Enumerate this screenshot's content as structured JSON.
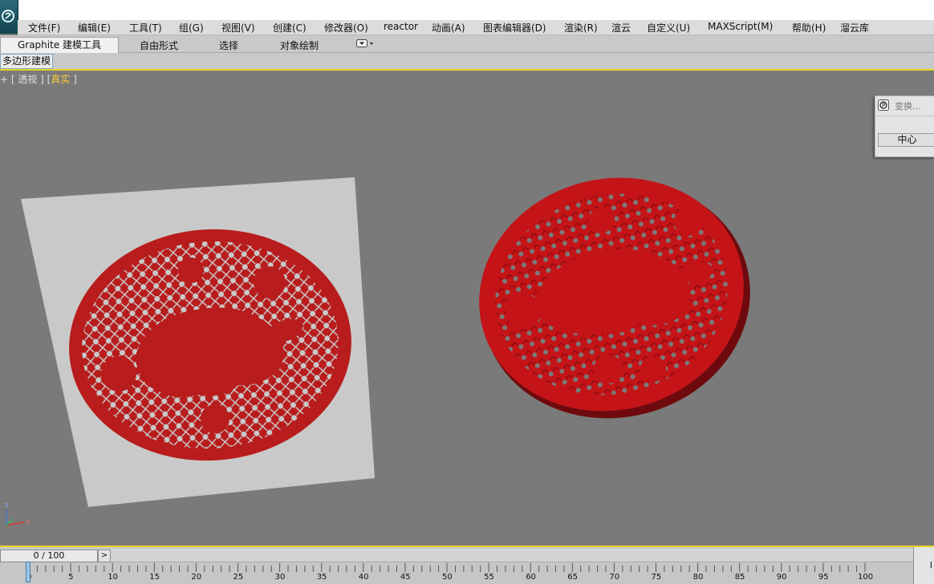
{
  "menubar": {
    "items": [
      "文件(F)",
      "编辑(E)",
      "工具(T)",
      "组(G)",
      "视图(V)",
      "创建(C)",
      "修改器(O)",
      "reactor",
      "动画(A)",
      "图表编辑器(D)",
      "渲染(R)",
      "渲云",
      "自定义(U)",
      "MAXScript(M)",
      "帮助(H)",
      "溜云库"
    ]
  },
  "ribbon": {
    "tabs": [
      "Graphite 建模工具",
      "自由形式",
      "选择",
      "对象绘制"
    ],
    "active_tab": "Graphite 建模工具",
    "subtab": "多边形建模"
  },
  "viewport": {
    "label_prefix": "+ [ 透视 ] [",
    "label_mode": "真实",
    "label_suffix": " ]",
    "axis_z": "z",
    "axis_x": "x"
  },
  "transform_panel": {
    "title": "变换...",
    "button": "中心"
  },
  "timeslider": {
    "position": "0 / 100",
    "next_label": ">",
    "ticks": [
      "0",
      "5",
      "10",
      "15",
      "20",
      "25",
      "30",
      "35",
      "40",
      "45",
      "50",
      "55",
      "60",
      "65",
      "70",
      "75",
      "80",
      "85",
      "90",
      "95",
      "100"
    ],
    "right_box": "I"
  },
  "colors": {
    "viewport_bg": "#7a7a7a",
    "paper_cut_red": "#b81c1c",
    "model_red": "#c41418",
    "highlight_yellow": "#e8d21b"
  },
  "icons": [
    "app-logo-icon",
    "ribbon-dropdown-icon",
    "transform-icon",
    "axis-gizmo-icon"
  ]
}
